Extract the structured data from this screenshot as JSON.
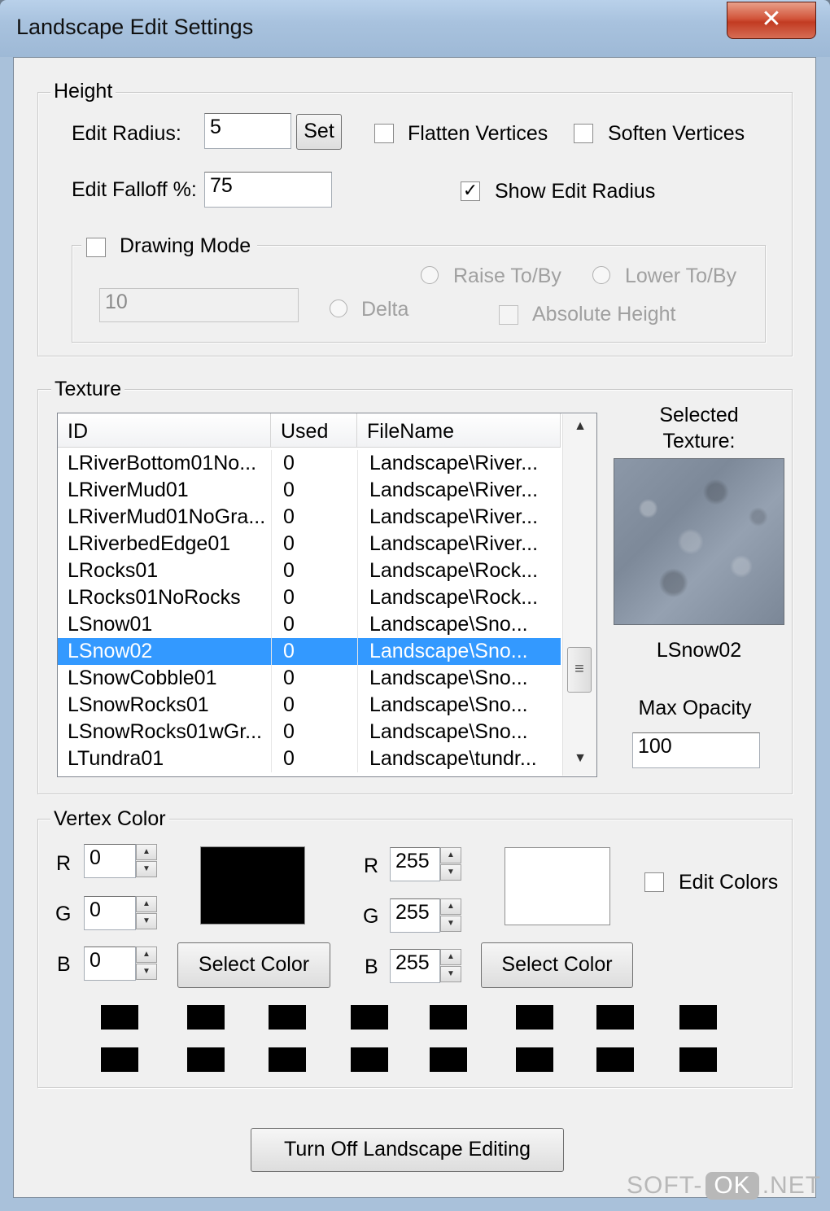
{
  "window": {
    "title": "Landscape Edit Settings",
    "close_glyph": "✕"
  },
  "height_group": {
    "legend": "Height",
    "edit_radius_label": "Edit Radius:",
    "edit_radius_value": "5",
    "set_button": "Set",
    "flatten_vertices_label": "Flatten Vertices",
    "flatten_vertices_checked": false,
    "soften_vertices_label": "Soften Vertices",
    "soften_vertices_checked": false,
    "edit_falloff_label": "Edit Falloff %:",
    "edit_falloff_value": "75",
    "show_edit_radius_label": "Show Edit Radius",
    "show_edit_radius_checked": true,
    "check_glyph": "✓",
    "drawing_mode": {
      "legend": "Drawing Mode",
      "checked": false,
      "value": "10",
      "raise_label": "Raise To/By",
      "lower_label": "Lower To/By",
      "delta_label": "Delta",
      "absolute_height_label": "Absolute Height"
    }
  },
  "texture_group": {
    "legend": "Texture",
    "columns": [
      "ID",
      "Used",
      "FileName"
    ],
    "rows": [
      [
        "LRiverBottom01No...",
        "0",
        "Landscape\\River..."
      ],
      [
        "LRiverMud01",
        "0",
        "Landscape\\River..."
      ],
      [
        "LRiverMud01NoGra...",
        "0",
        "Landscape\\River..."
      ],
      [
        "LRiverbedEdge01",
        "0",
        "Landscape\\River..."
      ],
      [
        "LRocks01",
        "0",
        "Landscape\\Rock..."
      ],
      [
        "LRocks01NoRocks",
        "0",
        "Landscape\\Rock..."
      ],
      [
        "LSnow01",
        "0",
        "Landscape\\Sno..."
      ],
      [
        "LSnow02",
        "0",
        "Landscape\\Sno..."
      ],
      [
        "LSnowCobble01",
        "0",
        "Landscape\\Sno..."
      ],
      [
        "LSnowRocks01",
        "0",
        "Landscape\\Sno..."
      ],
      [
        "LSnowRocks01wGr...",
        "0",
        "Landscape\\Sno..."
      ],
      [
        "LTundra01",
        "0",
        "Landscape\\tundr..."
      ]
    ],
    "selected_index": 7,
    "selected_texture_label_1": "Selected",
    "selected_texture_label_2": "Texture:",
    "selected_texture_name": "LSnow02",
    "max_opacity_label": "Max Opacity",
    "max_opacity_value": "100",
    "scroll_up_glyph": "▲",
    "scroll_down_glyph": "▼",
    "scroll_thumb_glyph": "≡"
  },
  "vertex_color_group": {
    "legend": "Vertex Color",
    "left": {
      "r_label": "R",
      "g_label": "G",
      "b_label": "B",
      "r": "0",
      "g": "0",
      "b": "0",
      "swatch_color": "#000000"
    },
    "right": {
      "r_label": "R",
      "g_label": "G",
      "b_label": "B",
      "r": "255",
      "g": "255",
      "b": "255",
      "swatch_color": "#ffffff"
    },
    "select_color_button": "Select Color",
    "edit_colors_label": "Edit Colors",
    "edit_colors_checked": false,
    "spin_up_glyph": "▲",
    "spin_down_glyph": "▼",
    "palette_color": "#000000"
  },
  "turn_off_button": "Turn Off Landscape Editing",
  "watermark": {
    "left": "SOFT-",
    "ok": "OK",
    "right": ".NET"
  },
  "colors": {
    "selection": "#3399ff",
    "dialog_bg": "#f0f0f0"
  }
}
